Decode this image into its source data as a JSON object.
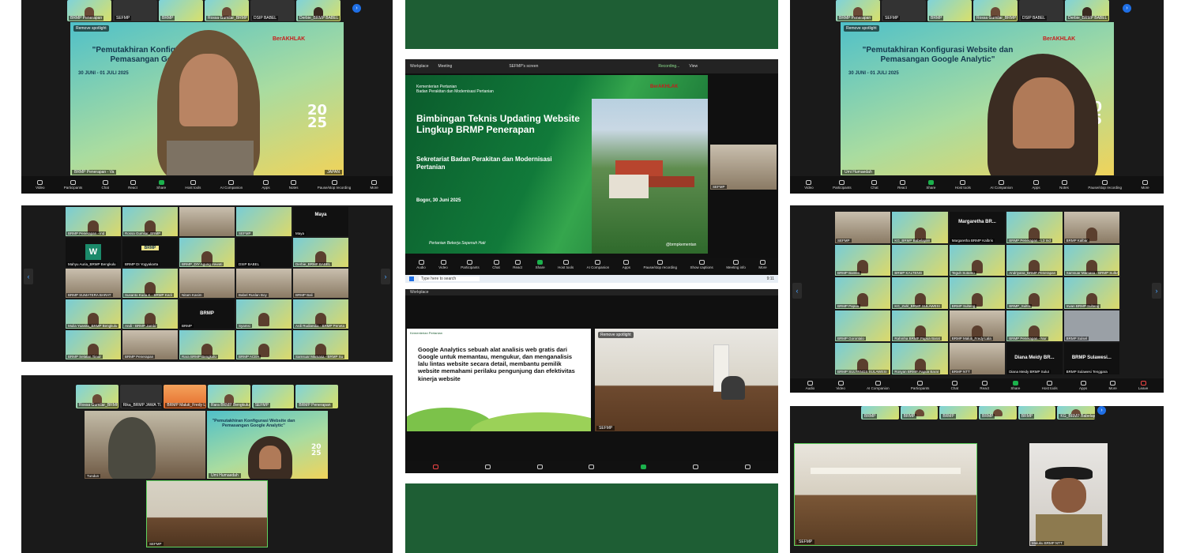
{
  "panels": {
    "top_left": {
      "strip": [
        "BRMP Penerapan",
        "SEFMP",
        "BRMP",
        "Rossa Gumilar_BRMP",
        "DSIP BABEL",
        "Derbie_BRMP BABEL"
      ],
      "spotlight_label": "Remove spotlight",
      "slide_title": "\"Pemutakhiran Konfigurasi Website dan Pemasangan Google Analytic\"",
      "slide_date": "30 JUNI - 01 JULI 2025",
      "year": "20\n25",
      "brand": "BerAKHLAK",
      "speaker": "BRMP Penerapan - Va",
      "footer_tag": "JAPAN"
    },
    "top_right": {
      "strip": [
        "BRMP Penerapan",
        "SEFMP",
        "BRMP",
        "Rossa Gumilar_BRMP",
        "DSIP BABEL",
        "Derbie_BRMP BABEL"
      ],
      "spotlight_label": "Remove spotlight",
      "slide_title": "\"Pemutakhiran Konfigurasi Website dan Pemasangan Google Analytic\"",
      "slide_date": "30 JUNI - 01 JULI 2025",
      "year": "20\n25",
      "brand": "BerAKHLAK",
      "speaker": "Umi Humaedah"
    },
    "toolbar": [
      "Video",
      "Participants",
      "Chat",
      "React",
      "Share",
      "Host tools",
      "AI Companion",
      "Apps",
      "Notes",
      "Pause/stop recording",
      "More"
    ],
    "toolbar_short": [
      "Audio",
      "Video",
      "AI Companion",
      "Participants",
      "Chat",
      "React",
      "Share",
      "Host tools",
      "Apps",
      "More",
      "Leave"
    ],
    "gallery_left": [
      "BRMP Penerapan - ind",
      "Rossa Gumilar_BRMP",
      "",
      "SEFMP",
      "Maya",
      "Mahyu Auria_BRMP Bengkulu",
      "BRMP DI Yogyakarta",
      "BRMP_DIY Agung Irawati",
      "DSIP BABEL",
      "Derbie_BRMP BABEL",
      "BRMP SUMATERA BARAT",
      "Susanto Kuda K - BRMP Kedi",
      "Nitam Kasim",
      "Babel Ruslan Boy",
      "BRMP Bali",
      "Mulia Yuanita_BRMP Bengkulu",
      "Andi - BRMP Jambi",
      "BRMP",
      "Syamsi",
      "Ardi Rudiandia - BRMP Peneta",
      "BRMP Selatan Timur",
      "BRMP Penerapan",
      "Rara BRMP Bengkulu",
      "BRMP ACEH",
      "Samsuar Mamasa - BRMP Su"
    ],
    "gallery_left_text": {
      "maya": "Maya",
      "w": "W",
      "brmp_logo": "BRMP",
      "brmp": "BRMP"
    },
    "gallery_right": [
      "SEFMP",
      "KG_BRMP Babelapan",
      "Margaretha BRMP Kalbris",
      "BRMP Penerapan - L3 Ind",
      "BRMP Kalbar",
      "BRMP Banten",
      "BRMP KALTENG",
      "Teguh Sutanto",
      "Andriyana_BRMP Penerapan",
      "Samsuar Mamasa - BRMP Sulbar",
      "BRMP Papua",
      "KG_Zahl_BRMP SULAWESI",
      "BRMP Sulteng",
      "BRMP_Sultra",
      "Irwan BRMP Sulteng",
      "BRMP Gorontalo",
      "Rahmha BRMP Papua Barat",
      "BRMP Maluti_Fredy Lala",
      "BRMP Penerapan - Nur",
      "BRMP Sulsel",
      "BRMP SULTRNGS SULAWESI",
      "Rosyan BRMP Papua Barat",
      "BRMP NTT",
      "Diana Meidy BRMP Sulut",
      "BRMP Sulawesi Tenggara"
    ],
    "gallery_right_text": {
      "margaretha": "Margaretha BR...",
      "diana": "Diana Meidy BR...",
      "sulawesi": "BRMP Sulawesi..."
    },
    "bottom_left": {
      "strip": [
        "Rossa Gumilar_BRMP",
        "Rika_BRMP JAWA TI...",
        "BRMP Maluti_Fredy Lala",
        "Rara BRMP Bengkulu",
        "SEFMP",
        "BRMP Penerapan"
      ],
      "person1": "Tundun",
      "person2": "Umi Humaedah",
      "room": "SEFMP",
      "slide_title": "\"Pemutakhiran Konfigurasi Website dan Pemasangan Google Analytic\"",
      "year": "20\n25"
    },
    "center_top": {
      "window_tabs": [
        "Workplace",
        "Meeting",
        "SEFMP's screen",
        "Recording...",
        "View"
      ],
      "org": "Kementerian Pertanian\nBadan Perakitan dan Modernisasi Pertanian",
      "title": "Bimbingan Teknis Updating Website Lingkup BRMP Penerapan",
      "subtitle": "Sekretariat Badan Perakitan dan Modernisasi Pertanian",
      "place_date": "Bogor, 30 Juni 2025",
      "tagline": "Pertanian Bekerja Sepenuh Hati",
      "handle": "@brmpkementan",
      "brand": "BerAKHLAK",
      "search": "Type here to search",
      "clock": "9:11",
      "pip_name": "SEFMP",
      "toolbar": [
        "Audio",
        "Video",
        "Participants",
        "Chat",
        "React",
        "Share",
        "Host tools",
        "AI Companion",
        "Apps",
        "Pause/stop recording",
        "Show captions",
        "Meeting info",
        "More"
      ]
    },
    "center_middle": {
      "header": "Workplace",
      "spotlight_label": "Remove spotlight",
      "org": "Kementerian Pertanian",
      "ga_text": "Google Analytics sebuah alat analisis web gratis dari Google untuk memantau, mengukur, dan menganalisis lalu lintas website secara detail, membantu pemilik website memahami perilaku pengunjung dan efektivitas kinerja website",
      "room_label": "SEFMP"
    },
    "bottom_right": {
      "strip": [
        "BRMP",
        "BRMP",
        "BRMP",
        "BRMP",
        "BRMP",
        "KG_BRMP Babelapan"
      ],
      "tile1": "SEFMP",
      "tile2": "Maluku BRMP NTT"
    }
  },
  "colors": {
    "zoom_dark": "#1a1a1a",
    "green_block": "#1e5e34",
    "slide_blue": "#14384f",
    "accent_blue": "#1f6fe5"
  }
}
